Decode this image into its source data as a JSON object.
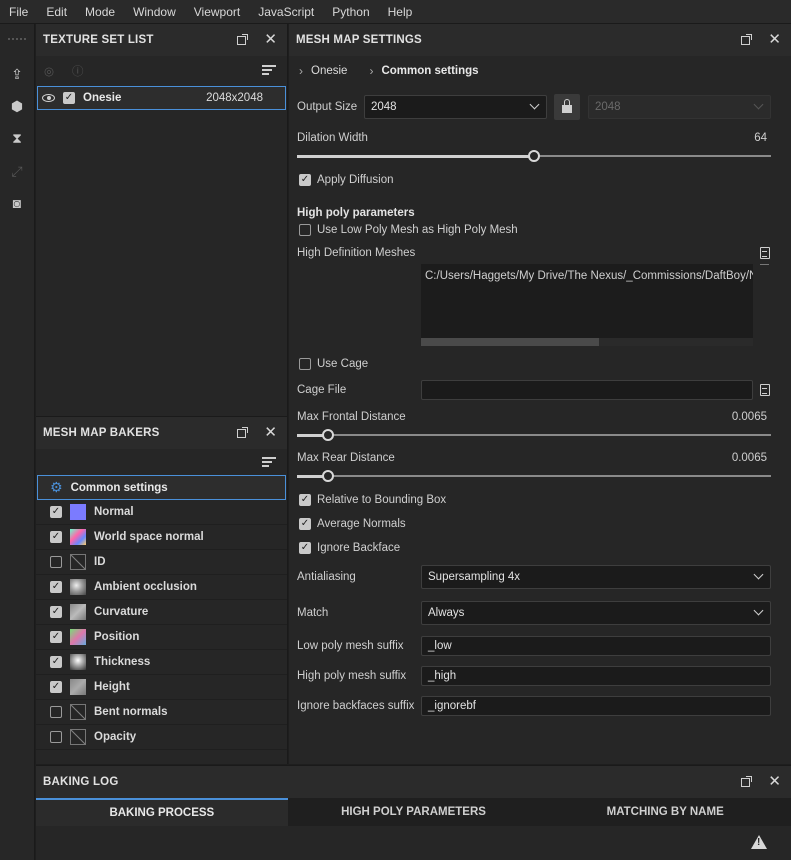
{
  "menu": [
    "File",
    "Edit",
    "Mode",
    "Window",
    "Viewport",
    "JavaScript",
    "Python",
    "Help"
  ],
  "toolstrip": [
    "export-icon",
    "bake-icon",
    "hourglass-icon",
    "resize-icon",
    "snapshot-icon"
  ],
  "texture_set_list": {
    "title": "TEXTURE SET LIST",
    "rows": [
      {
        "name": "Onesie",
        "resolution": "2048x2048",
        "visible": true,
        "enabled": true
      }
    ]
  },
  "mesh_map_bakers": {
    "title": "MESH MAP BAKERS",
    "common": "Common settings",
    "bakers": [
      {
        "label": "Normal",
        "checked": true,
        "thumb": "#7b7bff"
      },
      {
        "label": "World space normal",
        "checked": true,
        "thumb": "wsn"
      },
      {
        "label": "ID",
        "checked": false,
        "thumb": "none"
      },
      {
        "label": "Ambient occlusion",
        "checked": true,
        "thumb": "ao"
      },
      {
        "label": "Curvature",
        "checked": true,
        "thumb": "curv"
      },
      {
        "label": "Position",
        "checked": true,
        "thumb": "pos"
      },
      {
        "label": "Thickness",
        "checked": true,
        "thumb": "thick"
      },
      {
        "label": "Height",
        "checked": true,
        "thumb": "height"
      },
      {
        "label": "Bent normals",
        "checked": false,
        "thumb": "none"
      },
      {
        "label": "Opacity",
        "checked": false,
        "thumb": "none"
      }
    ]
  },
  "mesh_map_settings": {
    "title": "MESH MAP SETTINGS",
    "breadcrumb": [
      "Onesie",
      "Common settings"
    ],
    "output_size_label": "Output Size",
    "output_size": "2048",
    "output_size_locked": "2048",
    "dilation_label": "Dilation Width",
    "dilation_value": "64",
    "dilation_fraction": 0.5,
    "apply_diffusion": "Apply Diffusion",
    "high_poly_title": "High poly parameters",
    "use_low_poly": "Use Low Poly Mesh as High Poly Mesh",
    "hd_meshes_label": "High Definition Meshes",
    "hd_meshes_path": "C:/Users/Haggets/My Drive/The Nexus/_Commissions/DaftBoy/Na",
    "use_cage": "Use Cage",
    "cage_file_label": "Cage File",
    "cage_file": "",
    "max_frontal_label": "Max Frontal Distance",
    "max_frontal_value": "0.0065",
    "max_frontal_fraction": 0.065,
    "max_rear_label": "Max Rear Distance",
    "max_rear_value": "0.0065",
    "max_rear_fraction": 0.065,
    "relative_bbox": "Relative to Bounding Box",
    "average_normals": "Average Normals",
    "ignore_backface": "Ignore Backface",
    "antialiasing_label": "Antialiasing",
    "antialiasing": "Supersampling 4x",
    "match_label": "Match",
    "match": "Always",
    "low_suffix_label": "Low poly mesh suffix",
    "low_suffix": "_low",
    "high_suffix_label": "High poly mesh suffix",
    "high_suffix": "_high",
    "ignore_suffix_label": "Ignore backfaces suffix",
    "ignore_suffix": "_ignorebf"
  },
  "baking_log": {
    "title": "BAKING LOG",
    "tabs": [
      "BAKING PROCESS",
      "HIGH POLY PARAMETERS",
      "MATCHING BY NAME"
    ]
  },
  "accent": "#4a90d9"
}
